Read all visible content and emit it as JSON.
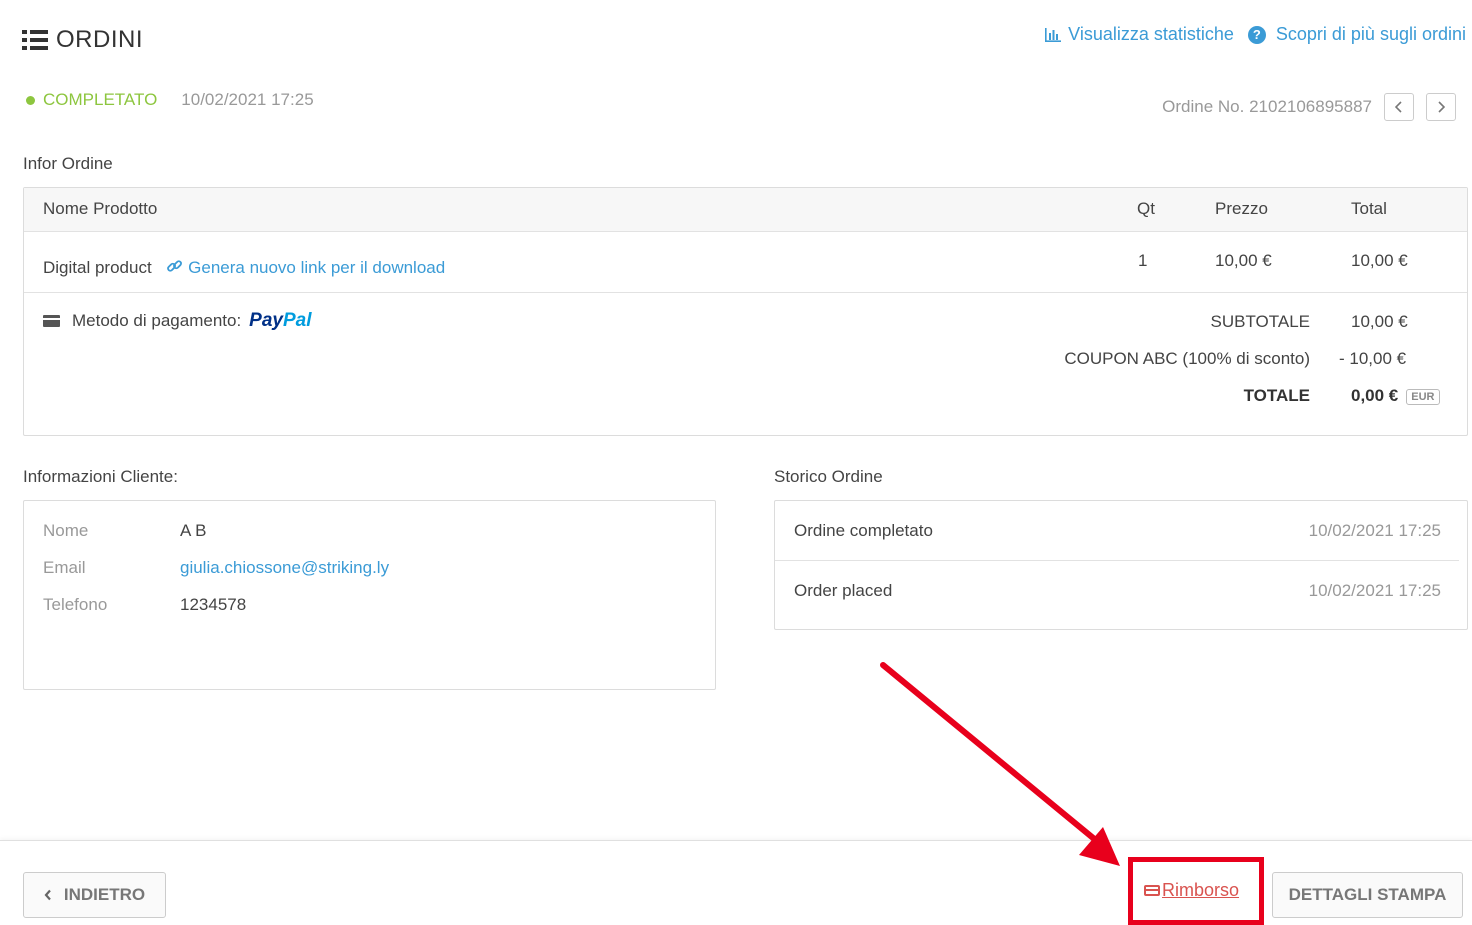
{
  "header": {
    "title": "ORDINI",
    "stats_link": "Visualizza statistiche",
    "help_link": "Scopri di più sugli ordini",
    "help_glyph": "?"
  },
  "status": {
    "label": "COMPLETATO",
    "date": "10/02/2021 17:25",
    "color": "#8dc63f"
  },
  "order_no": "Ordine No. 2102106895887",
  "order_info": {
    "title": "Infor Ordine",
    "columns": {
      "product": "Nome Prodotto",
      "qty": "Qt",
      "price": "Prezzo",
      "total": "Total"
    },
    "items": [
      {
        "name": "Digital product",
        "link": "Genera nuovo link per il download",
        "qty": "1",
        "price": "10,00 €",
        "total": "10,00 €"
      }
    ],
    "payment_label": "Metodo di pagamento:",
    "payment_brand_pay": "Pay",
    "payment_brand_pal": "Pal",
    "subtotal_label": "SUBTOTALE",
    "subtotal_value": "10,00 €",
    "coupon_label": "COUPON ABC (100% di sconto)",
    "coupon_value": "- 10,00 €",
    "total_label": "TOTALE",
    "total_value": "0,00 €",
    "currency": "EUR"
  },
  "customer": {
    "title": "Informazioni Cliente:",
    "name_label": "Nome",
    "name": "A B",
    "email_label": "Email",
    "email": "giulia.chiossone@striking.ly",
    "phone_label": "Telefono",
    "phone": "1234578"
  },
  "history": {
    "title": "Storico Ordine",
    "events": [
      {
        "label": "Ordine completato",
        "date": "10/02/2021 17:25"
      },
      {
        "label": "Order placed",
        "date": "10/02/2021 17:25"
      }
    ]
  },
  "footer": {
    "back": "INDIETRO",
    "refund": "Rimborso",
    "print": "DETTAGLI STAMPA"
  },
  "colors": {
    "link": "#3b9bd6",
    "highlight": "#e8001c",
    "refund": "#d9534f"
  }
}
